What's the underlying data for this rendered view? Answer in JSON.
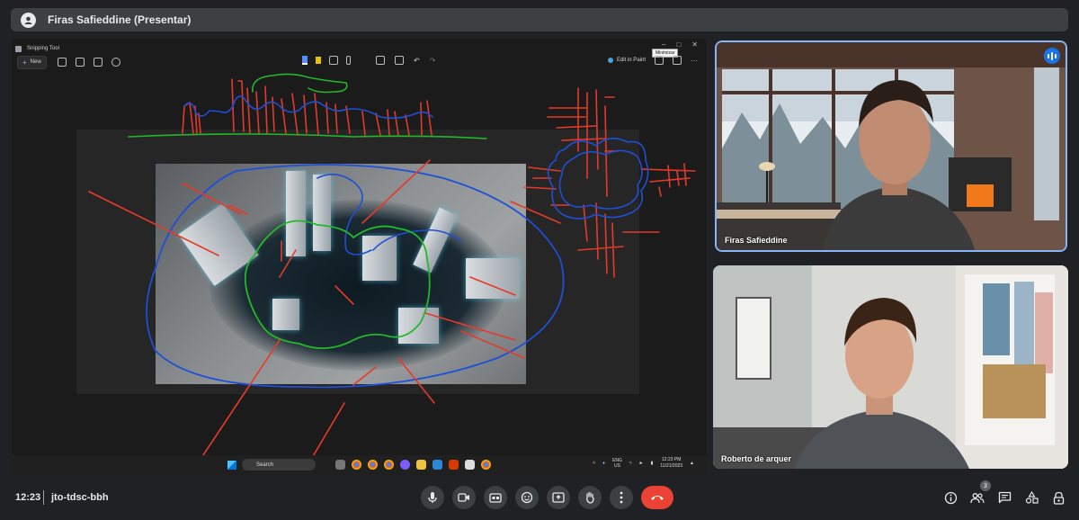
{
  "presenter": {
    "name": "Firas Safieddine (Presentar)"
  },
  "snipping_tool": {
    "title": "Snipping Tool",
    "new_label": "New",
    "edit_in_paint_label": "Edit in Paint",
    "tooltip": "Minimizar",
    "more_label": "···"
  },
  "taskbar": {
    "search_placeholder": "Search",
    "lang_1": "ENG",
    "lang_2": "US",
    "time": "12:23 PM",
    "date": "11/21/2023"
  },
  "participants": [
    {
      "name": "Firas Safieddine",
      "speaking": true
    },
    {
      "name": "Roberto de arquer",
      "speaking": false
    }
  ],
  "meeting": {
    "time": "12:23",
    "separator": "|",
    "code": "jto-tdsc-bbh"
  },
  "people_count": "3",
  "colors": {
    "background": "#202124",
    "accent": "#8ab4f8",
    "end_call": "#ea4335",
    "ink_red": "#e53a2a",
    "ink_blue": "#1e4fd6",
    "ink_green": "#22b829"
  }
}
